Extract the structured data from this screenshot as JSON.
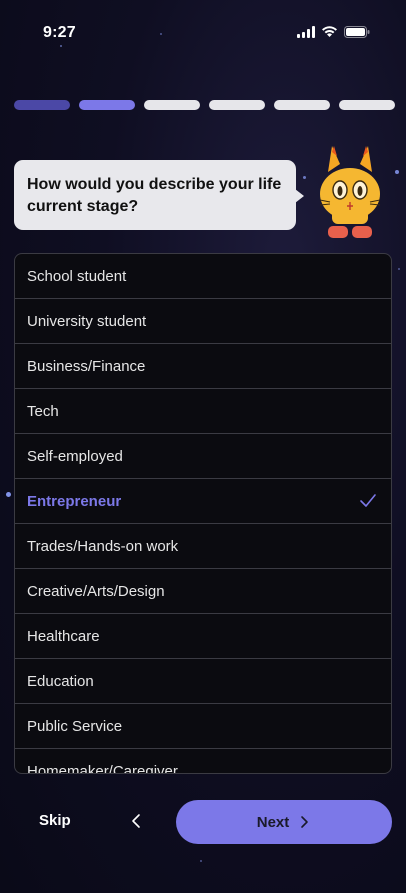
{
  "status_bar": {
    "time": "9:27"
  },
  "progress": {
    "total": 6,
    "completed": 2
  },
  "question": "How would you describe your life current stage?",
  "options": [
    "School student",
    "University student",
    "Business/Finance",
    "Tech",
    "Self-employed",
    "Entrepreneur",
    "Trades/Hands-on work",
    "Creative/Arts/Design",
    "Healthcare",
    "Education",
    "Public Service",
    "Homemaker/Caregiver"
  ],
  "selected_option": "Entrepreneur",
  "footer": {
    "skip_label": "Skip",
    "next_label": "Next"
  },
  "colors": {
    "accent": "#7c78e8",
    "background": "#0f0e22"
  },
  "icons": [
    "signal-icon",
    "wifi-icon",
    "battery-icon",
    "check-icon",
    "chevron-left-icon",
    "chevron-right-icon",
    "mascot-cat-icon"
  ]
}
